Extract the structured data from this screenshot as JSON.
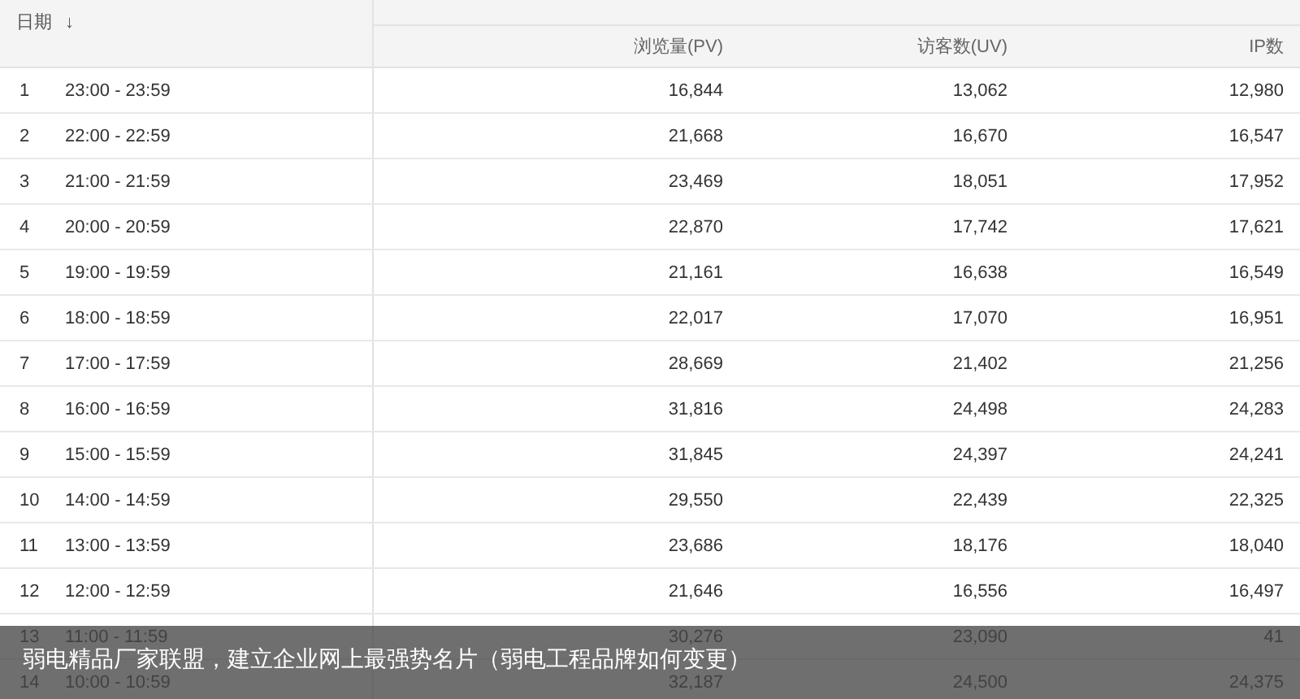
{
  "table": {
    "date_header": "日期",
    "sort_icon": "↓",
    "columns": [
      "浏览量(PV)",
      "访客数(UV)",
      "IP数"
    ],
    "rows": [
      {
        "index": "1",
        "time": "23:00 - 23:59",
        "pv": "16,844",
        "uv": "13,062",
        "ip": "12,980"
      },
      {
        "index": "2",
        "time": "22:00 - 22:59",
        "pv": "21,668",
        "uv": "16,670",
        "ip": "16,547"
      },
      {
        "index": "3",
        "time": "21:00 - 21:59",
        "pv": "23,469",
        "uv": "18,051",
        "ip": "17,952"
      },
      {
        "index": "4",
        "time": "20:00 - 20:59",
        "pv": "22,870",
        "uv": "17,742",
        "ip": "17,621"
      },
      {
        "index": "5",
        "time": "19:00 - 19:59",
        "pv": "21,161",
        "uv": "16,638",
        "ip": "16,549"
      },
      {
        "index": "6",
        "time": "18:00 - 18:59",
        "pv": "22,017",
        "uv": "17,070",
        "ip": "16,951"
      },
      {
        "index": "7",
        "time": "17:00 - 17:59",
        "pv": "28,669",
        "uv": "21,402",
        "ip": "21,256"
      },
      {
        "index": "8",
        "time": "16:00 - 16:59",
        "pv": "31,816",
        "uv": "24,498",
        "ip": "24,283"
      },
      {
        "index": "9",
        "time": "15:00 - 15:59",
        "pv": "31,845",
        "uv": "24,397",
        "ip": "24,241"
      },
      {
        "index": "10",
        "time": "14:00 - 14:59",
        "pv": "29,550",
        "uv": "22,439",
        "ip": "22,325"
      },
      {
        "index": "11",
        "time": "13:00 - 13:59",
        "pv": "23,686",
        "uv": "18,176",
        "ip": "18,040"
      },
      {
        "index": "12",
        "time": "12:00 - 12:59",
        "pv": "21,646",
        "uv": "16,556",
        "ip": "16,497"
      },
      {
        "index": "13",
        "time": "11:00 - 11:59",
        "pv": "30,276",
        "uv": "23,090",
        "ip": "41"
      },
      {
        "index": "14",
        "time": "10:00 - 10:59",
        "pv": "32,187",
        "uv": "24,500",
        "ip": "24,375"
      }
    ]
  },
  "caption": "弱电精品厂家联盟，建立企业网上最强势名片（弱电工程品牌如何变更）"
}
